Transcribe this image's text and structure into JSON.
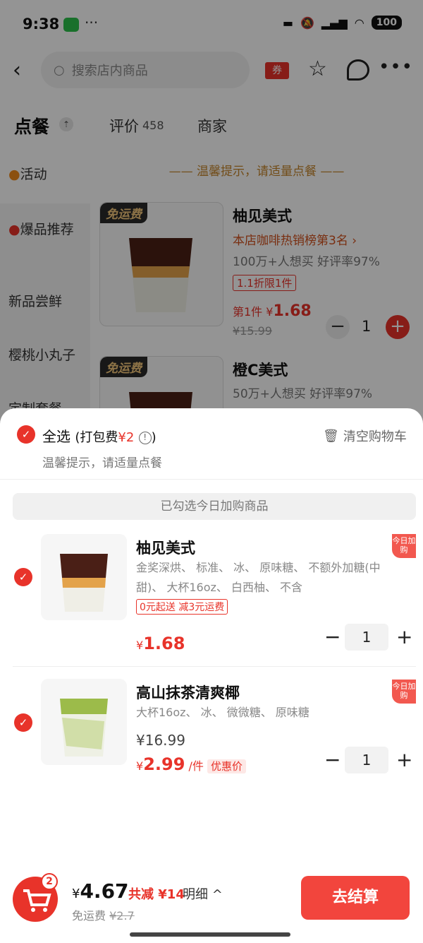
{
  "status": {
    "time": "9:38",
    "battery": "100"
  },
  "header": {
    "search_placeholder": "搜索店内商品",
    "coupon": "券"
  },
  "tabs": {
    "order": "点餐",
    "reviews": "评价",
    "reviews_count": "458",
    "merchant": "商家"
  },
  "sidebar": [
    "活动",
    "爆品推荐",
    "新品尝鲜",
    "樱桃小丸子",
    "定制套餐"
  ],
  "menu": {
    "tip": "—— 温馨提示，请适量点餐 ——",
    "free_tag": "免运费",
    "products": [
      {
        "name": "柚见美式",
        "rank": "本店咖啡热销榜第3名 ›",
        "meta": "100万+人想买 好评率97%",
        "discount": "1.1折限1件",
        "price_prefix": "第1件 ¥",
        "price": "1.68",
        "old_price": "¥15.99",
        "qty": "1"
      },
      {
        "name": "橙C美式",
        "meta": "50万+人想买 好评率97%"
      }
    ]
  },
  "cart": {
    "select_all": "全选",
    "pack_fee_label": "(打包费",
    "pack_fee_value": "¥2",
    "pack_fee_end": ")",
    "clear": "清空购物车",
    "tip": "温馨提示，请适量点餐",
    "banner": "已勾选今日加购商品",
    "today_tag": "今日加购",
    "items": [
      {
        "name": "柚见美式",
        "spec": "金奖深烘、 标准、 冰、 原味糖、 不额外加糖(中甜)、 大杯16oz、 白西柚、 不含",
        "tag": "0元起送 减3元运费",
        "currency": "¥",
        "price": "1.68",
        "qty": "1"
      },
      {
        "name": "高山抹茶清爽椰",
        "spec": "大杯16oz、 冰、 微微糖、 原味糖",
        "orig_price": "¥16.99",
        "currency": "¥",
        "price": "2.99",
        "unit": "/件",
        "deal_tag": "优惠价",
        "qty": "1"
      }
    ]
  },
  "bottom": {
    "badge": "2",
    "currency": "¥",
    "total": "4.67",
    "saved": "共减 ¥14",
    "detail": "明细 ^",
    "freeship_label": "免运费",
    "freeship_old": "¥2.7",
    "checkout": "去结算"
  },
  "colors": {
    "accent": "#e8332a",
    "gold": "#c5852b"
  }
}
